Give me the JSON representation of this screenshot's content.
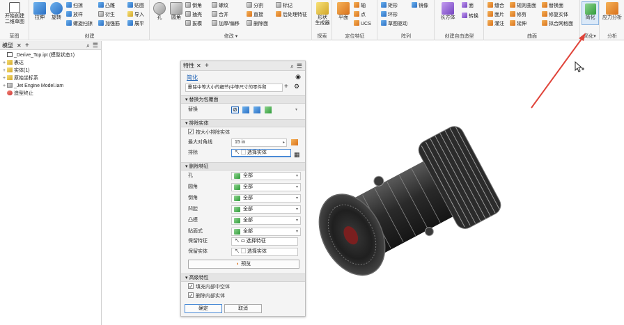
{
  "ribbon": {
    "sketch": {
      "title": "草图",
      "start_label": "开始创建\n二维草图"
    },
    "create": {
      "title": "创建",
      "extrude": "拉伸",
      "revolve": "旋转",
      "small": [
        "扫掠",
        "放样",
        "螺旋扫掠",
        "凸雕",
        "衍生",
        "加强筋",
        "贴图",
        "导入",
        "展平"
      ]
    },
    "modify": {
      "title": "修改",
      "hole": "孔",
      "fillet": "圆角",
      "small": [
        "倒角",
        "抽壳",
        "拔模",
        "螺纹",
        "合并",
        "加厚/偏移",
        "分割",
        "直接",
        "删除面",
        "标记",
        "后处理特征"
      ]
    },
    "explore": {
      "title": "探索",
      "shape_gen": "形状\n生成器"
    },
    "work_features": {
      "title": "定位特征",
      "plane": "平面",
      "small": [
        "轴",
        "点",
        "UCS"
      ]
    },
    "pattern": {
      "title": "阵列",
      "small": [
        "矩形",
        "环形",
        "草图驱动",
        "镜像"
      ]
    },
    "freeform": {
      "title": "创建自由造型",
      "box": "长方体",
      "small": [
        "面",
        "转换"
      ]
    },
    "surface": {
      "title": "曲面",
      "small": [
        "缝合",
        "规则曲面",
        "替换面",
        "面片",
        "修剪",
        "修复实体",
        "灌注",
        "延伸",
        "拟合网格面"
      ]
    },
    "simplify": {
      "title": "简化",
      "label": "简化"
    },
    "analysis": {
      "title": "分析",
      "label": "应力分析"
    }
  },
  "browser": {
    "tab_label": "模型",
    "close_glyph": "✕",
    "add_glyph": "+",
    "items": [
      {
        "label": "_Derive_Top.ipt (模型状态1)",
        "level": 0,
        "icon": "part-icon",
        "exp": ""
      },
      {
        "label": "表达",
        "level": 1,
        "icon": "folder-icon",
        "exp": "+"
      },
      {
        "label": "实体(1)",
        "level": 1,
        "icon": "folder-icon",
        "exp": "+"
      },
      {
        "label": "原始坐标系",
        "level": 1,
        "icon": "folder-icon",
        "exp": "+"
      },
      {
        "label": "_Jet Engine Model.iam",
        "level": 1,
        "icon": "assembly-icon",
        "exp": "+"
      },
      {
        "label": "造型终止",
        "level": 1,
        "icon": "end-of-part-icon",
        "exp": ""
      }
    ]
  },
  "props": {
    "tab_label": "特性",
    "close_glyph": "✕",
    "add_glyph": "+",
    "title": "简化",
    "preset": "删除中等大小的细节(中等尺寸的零件和",
    "sections": {
      "envelope": "替换为包覆面",
      "exclude": "排除实体",
      "remove": "删除特征",
      "advanced": "高级特性"
    },
    "replace_label": "替换",
    "exclude_by_size": "按大小排除实体",
    "max_diag_label": "最大对角线",
    "max_diag_value": "15 in",
    "exclude_label": "排除",
    "select_body": "选择实体",
    "features": [
      {
        "label": "孔",
        "value": "全部"
      },
      {
        "label": "圆角",
        "value": "全部"
      },
      {
        "label": "倒角",
        "value": "全部"
      },
      {
        "label": "凹腔",
        "value": "全部"
      },
      {
        "label": "凸模",
        "value": "全部"
      },
      {
        "label": "贴面式",
        "value": "全部"
      }
    ],
    "keep_feature_label": "保留特征",
    "keep_feature_value": "选择特征",
    "keep_body_label": "保留实体",
    "keep_body_value": "选择实体",
    "preview": "预览",
    "fill_voids": "填充内部中空体",
    "remove_internal": "删除内部实体",
    "ok": "确定",
    "cancel": "取消"
  }
}
